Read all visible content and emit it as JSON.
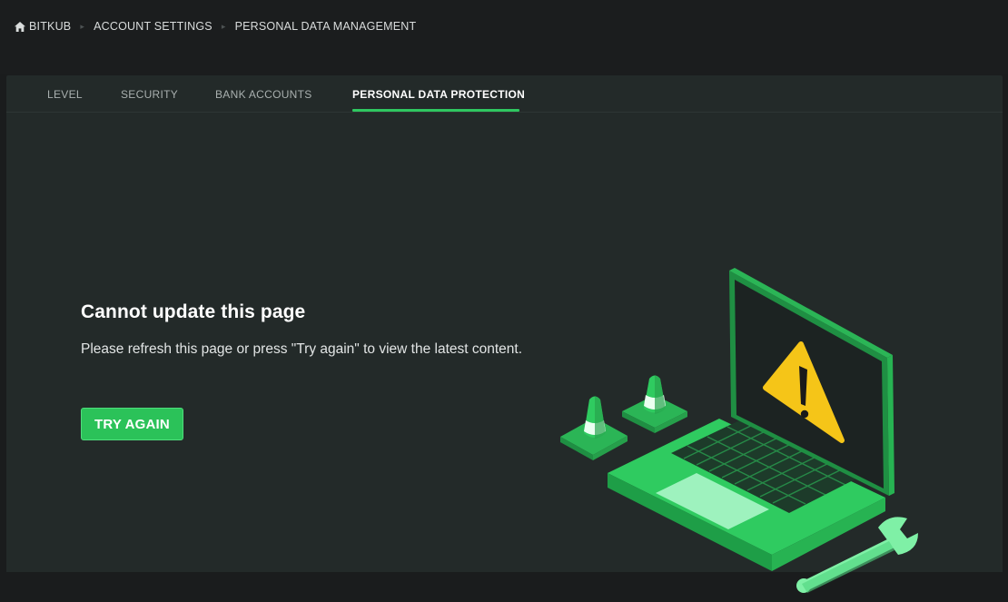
{
  "breadcrumb": {
    "items": [
      {
        "label": "BITKUB",
        "icon": "home-icon"
      },
      {
        "label": "ACCOUNT SETTINGS"
      },
      {
        "label": "PERSONAL DATA MANAGEMENT"
      }
    ],
    "separator": "▸"
  },
  "tabs": [
    {
      "label": "LEVEL",
      "active": false
    },
    {
      "label": "SECURITY",
      "active": false
    },
    {
      "label": "BANK ACCOUNTS",
      "active": false
    },
    {
      "label": "PERSONAL DATA PROTECTION",
      "active": true
    }
  ],
  "error": {
    "title": "Cannot update this page",
    "message": "Please refresh this page or press \"Try again\" to view the latest content.",
    "button_label": "TRY AGAIN"
  },
  "illustration": {
    "icons": [
      "traffic-cone-icon",
      "laptop-icon",
      "warning-icon",
      "wrench-icon"
    ]
  },
  "colors": {
    "accent": "#2bc259",
    "background": "#1a1c1d",
    "panel": "#232a29",
    "warning": "#f5c518"
  }
}
